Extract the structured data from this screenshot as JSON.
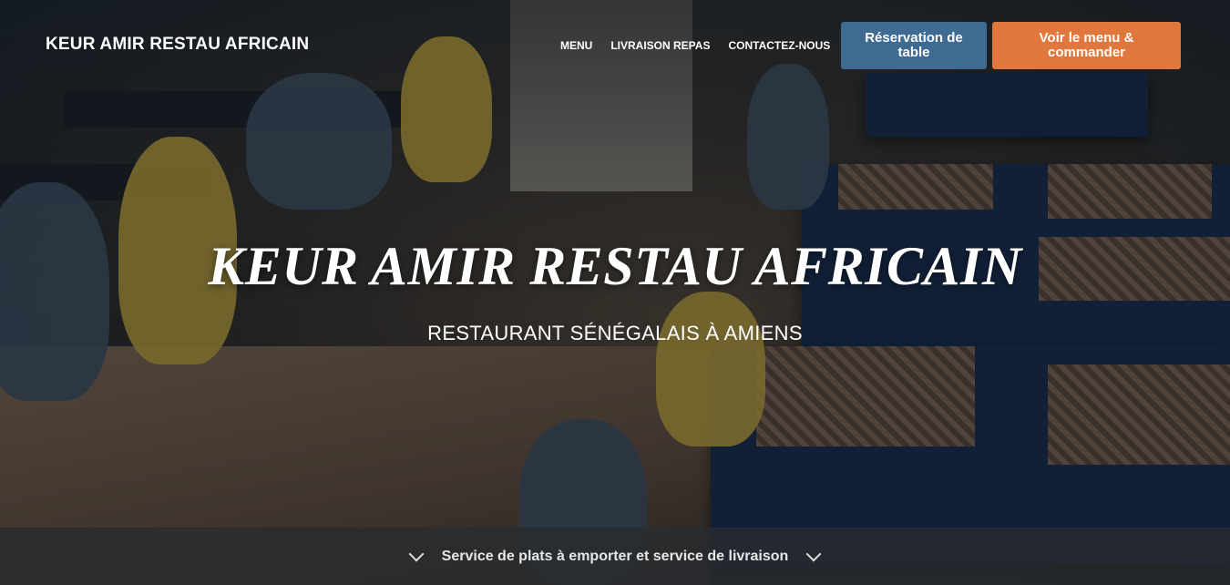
{
  "header": {
    "brand": "KEUR AMIR RESTAU AFRICAIN",
    "nav": [
      "MENU",
      "LIVRAISON REPAS",
      "CONTACTEZ-NOUS"
    ],
    "reserve_button": "Réservation de table",
    "menu_button": "Voir le menu & commander"
  },
  "hero": {
    "title": "KEUR AMIR RESTAU AFRICAIN",
    "subtitle": "RESTAURANT SÉNÉGALAIS À AMIENS"
  },
  "bottom_bar": {
    "label": "Service de plats à emporter et service de livraison"
  },
  "colors": {
    "reserve_button": "#3f6a92",
    "menu_button": "#e0773c"
  }
}
